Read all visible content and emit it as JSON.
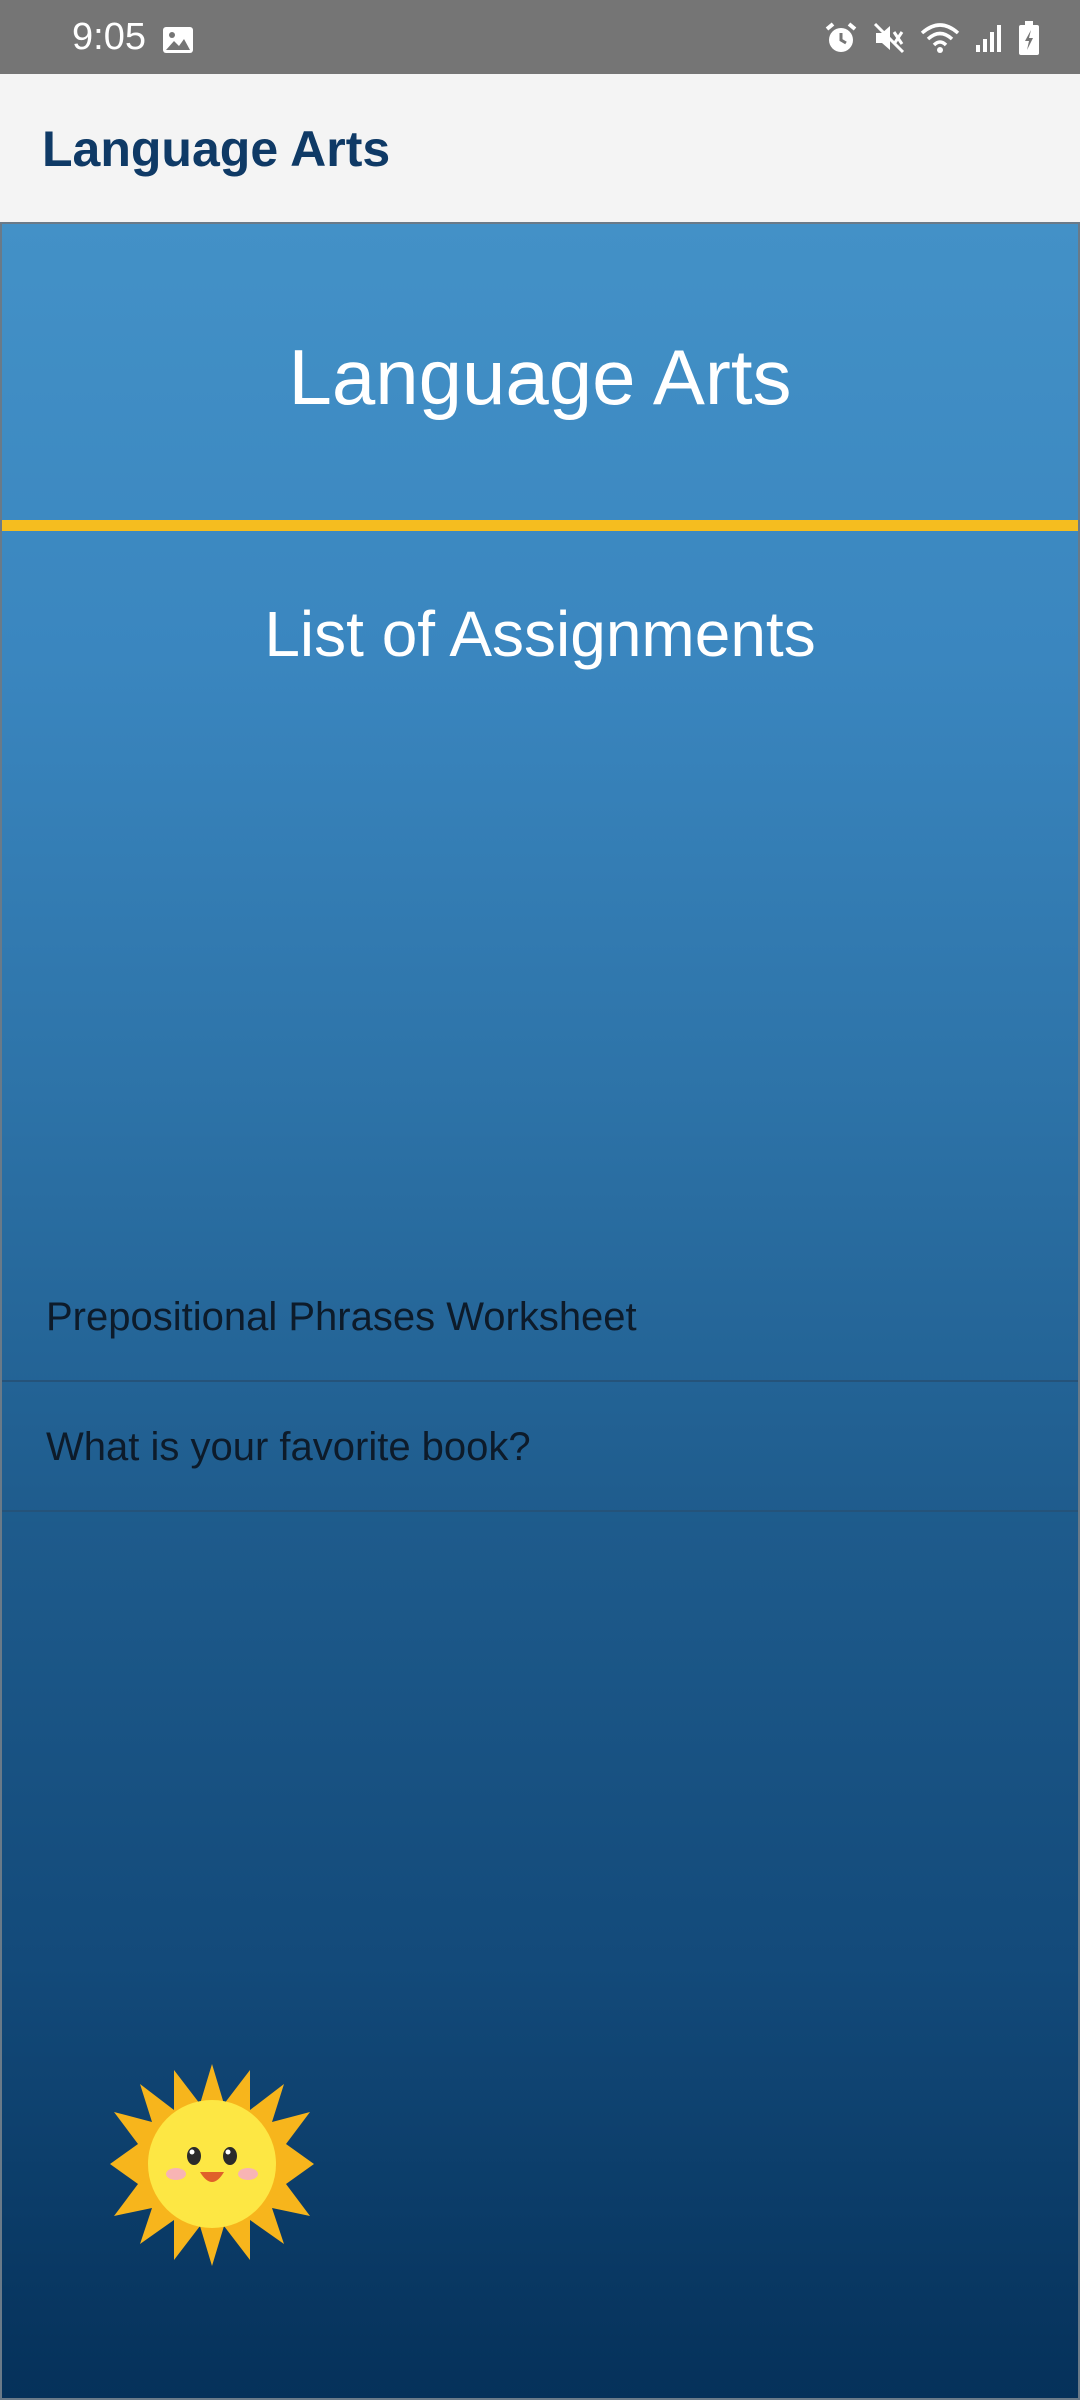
{
  "status_bar": {
    "time": "9:05",
    "icons": [
      "image-icon",
      "alarm-icon",
      "mute-icon",
      "wifi-icon",
      "signal-icon",
      "battery-charging-icon"
    ]
  },
  "app_bar": {
    "title": "Language Arts"
  },
  "main": {
    "hero_title": "Language Arts",
    "section_heading": "List of Assignments",
    "assignments": [
      {
        "label": "Prepositional Phrases Worksheet"
      },
      {
        "label": "What is your favorite book?"
      }
    ],
    "mascot": "sun-mascot"
  },
  "colors": {
    "status_bar": "#757575",
    "app_bar": "#f4f4f4",
    "app_bar_title": "#0f3a66",
    "gradient_top": "#4391c7",
    "gradient_bottom": "#05315a",
    "accent": "#f5bd1f"
  }
}
